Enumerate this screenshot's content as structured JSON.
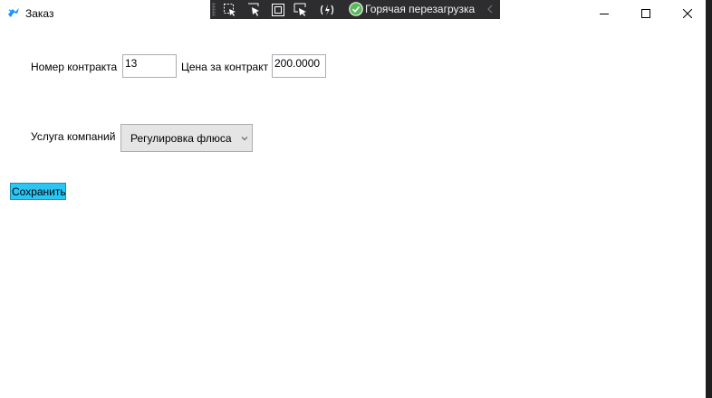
{
  "window": {
    "title": "Заказ",
    "icon": "app-bird-icon",
    "controls": [
      "minimize-icon",
      "maximize-icon",
      "close-icon"
    ]
  },
  "debug_toolbar": {
    "buttons": [
      "select-element-icon",
      "display-layout-adorners-icon",
      "track-focused-element-icon",
      "binding-failures-icon",
      "hot-reload-icon"
    ],
    "hot_reload_label": "Горячая перезагрузка",
    "status_icon": "check-circle-icon"
  },
  "form": {
    "contract_number_label": "Номер контракта",
    "contract_number_value": "13",
    "price_label": "Цена за контракт",
    "price_value": "200.0000",
    "service_label": "Услуга компаний",
    "service_selected": "Регулировка флюса",
    "save_label": "Сохранить"
  },
  "colors": {
    "save_button": "#29c6f5",
    "toolbar_background": "#2d2d30",
    "app_icon": "#1e90ff",
    "check": "#5cb85c"
  }
}
